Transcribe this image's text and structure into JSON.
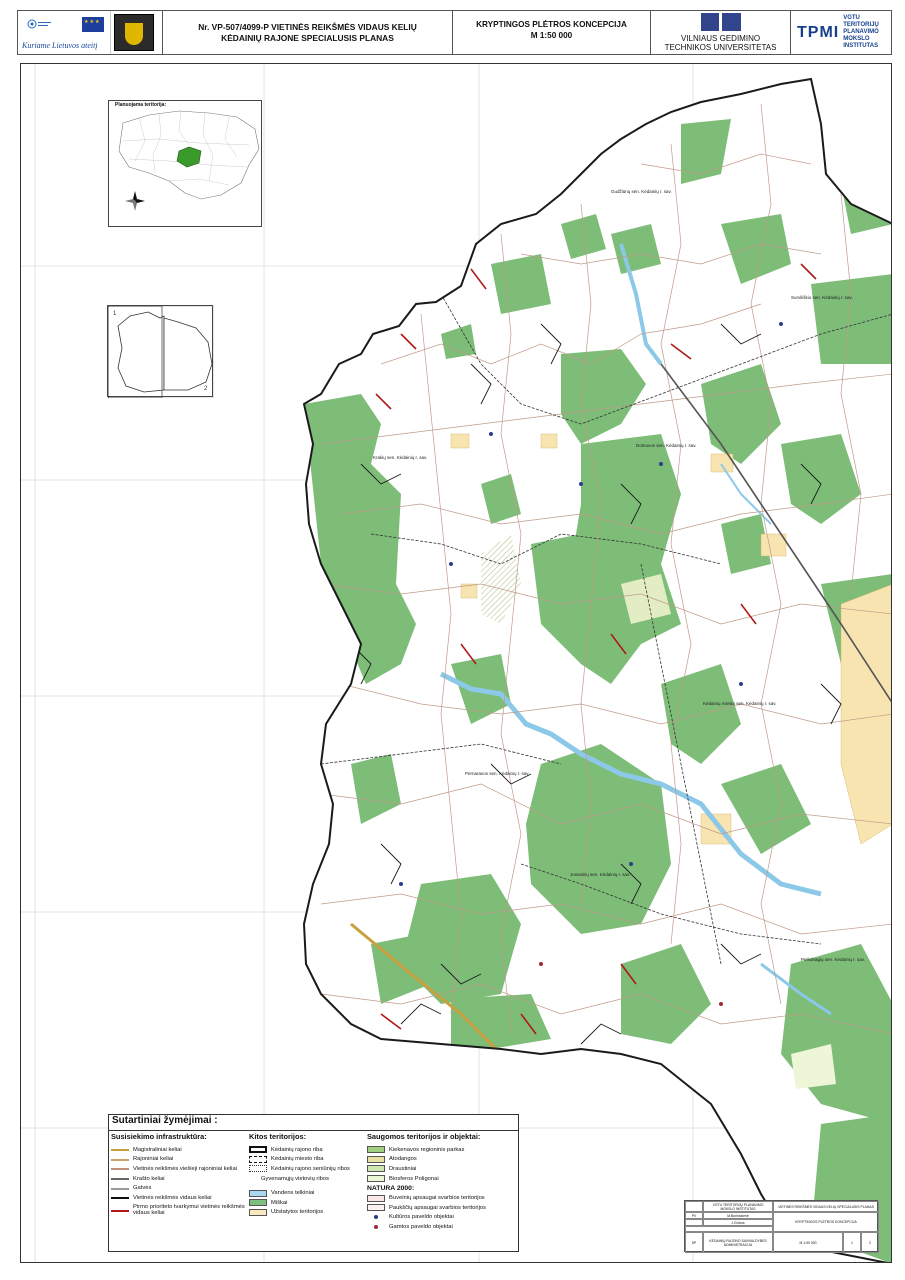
{
  "header": {
    "slogan": "Kuriame Lietuvos ateitį",
    "project_line1": "Nr. VP-507/4099-P VIETINĖS REIKŠMĖS VIDAUS KELIŲ",
    "project_line2": "KĖDAINIŲ RAJONE SPECIALUSIS PLANAS",
    "concept_line1": "KRYPTINGOS PLĖTROS KONCEPCIJA",
    "concept_line2": "M 1:50 000",
    "vgtu_line1": "VILNIAUS GEDIMINO",
    "vgtu_line2": "TECHNIKOS UNIVERSITETAS",
    "tpmi_abbr": "TPMI",
    "tpmi_line1": "VGTU",
    "tpmi_line2": "TERITORIJŲ",
    "tpmi_line3": "PLANAVIMO",
    "tpmi_line4": "MOKSLO",
    "tpmi_line5": "INSTITUTAS"
  },
  "insets": {
    "lithuania_title": "Planuojama teritorija:",
    "sheet_1": "1",
    "sheet_2": "2"
  },
  "map_labels": [
    {
      "text": "Gudžiūnų sen. Kėdainių r. sav."
    },
    {
      "text": "Surviliškio sen. Kėdainių r. sav."
    },
    {
      "text": "Dotnuvos sen. Kėdainių r. sav."
    },
    {
      "text": "Krakių sen. Kėdainių r. sav."
    },
    {
      "text": "Kėdainių miesto sen. Kėdainių r. sav."
    },
    {
      "text": "Pernaravos sen. Kėdainių r. sav."
    },
    {
      "text": "Josvainių sen. Kėdainių r. sav."
    },
    {
      "text": "Pelėdnagių sen. Kėdainių r. sav."
    }
  ],
  "legend": {
    "title": "Sutartiniai žymėjimai :",
    "col1_head": "Susisiekimo infrastruktūra:",
    "col1_items": [
      {
        "label": "Magistraliniai keliai",
        "color": "#c8a040"
      },
      {
        "label": "Rajoniniai keliai",
        "color": "#c8a070"
      },
      {
        "label": "Vietinės reikšmės viešieji rajoniniai keliai",
        "color": "#c0907a"
      },
      {
        "label": "Krašto keliai",
        "color": "#666666"
      },
      {
        "label": "Gatvės",
        "color": "#999999"
      },
      {
        "label": "Vietinės reikšmės vidaus keliai",
        "color": "#111111"
      }
    ],
    "col1_priority": "Pirmo prioriteto tvarkymui vietinės reikšmės vidaus keliai",
    "col1_priority_color": "#b01818",
    "col2_head": "Kitos teritorijos:",
    "col2_items": [
      {
        "label": "Kėdainių rajono riba",
        "style": "bold"
      },
      {
        "label": "Kėdainių miesto riba",
        "style": "dash"
      },
      {
        "label": "Kėdainių rajono seniūnijų ribos",
        "style": "dot"
      }
    ],
    "col2_settlements": "Gyvenamųjų vietovių ribos",
    "col2_areas": [
      {
        "label": "Vandens telkiniai",
        "color": "#a9d8ef"
      },
      {
        "label": "Miškai",
        "color": "#7fbf7f"
      },
      {
        "label": "Užstatytos teritorijos",
        "color": "#f7e9c0"
      }
    ],
    "col3_head": "Saugomos teritorijos ir objektai:",
    "col3_items": [
      {
        "label": "Kiekenavos regioninis parkas",
        "color": "#9fcf7f"
      },
      {
        "label": "Atodangos",
        "color": "#e8e0a0"
      },
      {
        "label": "Draustiniai",
        "color": "#cfe6b0"
      },
      {
        "label": "Biosferos Poligonai",
        "color": "#eef6d8"
      }
    ],
    "col3_natura": "NATURA 2000:",
    "col3_natura_items": [
      {
        "label": "Buveinių apsaugai svarbios teritorijos",
        "color": "#fbe7e7"
      },
      {
        "label": "Paukščių apsaugai svarbios teritorijos",
        "color": "#fdf3f3"
      }
    ],
    "col3_points": [
      {
        "label": "Kultūros paveldo objektai",
        "color": "#2e3c8c"
      },
      {
        "label": "Gamtos paveldo objektai",
        "color": "#a02838"
      }
    ]
  },
  "stamp": {
    "org": "VGTU TERITORIJŲ PLANAVIMO MOKSLO INSTITUTAS",
    "project": "VIETINĖS REIKŠMĖS VIDAUS KELIŲ SPECIALUSIS PLANAS",
    "sheet_title": "KRYPTINGOS PLĖTROS KONCEPCIJA",
    "client": "KĖDAINIŲ RAJONO SAVIVALDYBĖS ADMINISTRACIJA",
    "scale": "M 1:50 000",
    "role_pv": "PV",
    "role_name_pv": "M.Burinskienė",
    "role_name_2": "J.Gricius",
    "sheet_no": "1",
    "sheets": "2",
    "stage": "SP"
  },
  "colors": {
    "forest": "#7dbd78",
    "water": "#a9d8ef",
    "built": "#f7e4b0",
    "boundary": "#1a1a1a",
    "priority_road": "#b01818",
    "minor_road": "#c09a8a"
  }
}
